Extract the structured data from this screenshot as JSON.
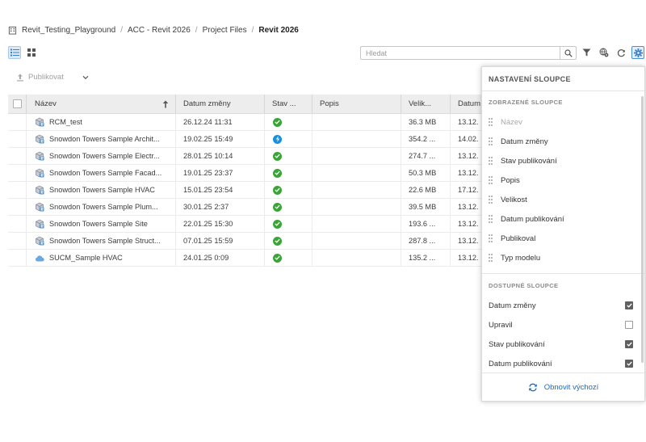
{
  "breadcrumb": {
    "items": [
      "Revit_Testing_Playground",
      "ACC - Revit 2026",
      "Project Files",
      "Revit 2026"
    ],
    "separator": "/"
  },
  "toolbar": {
    "search_placeholder": "Hledat",
    "publish_label": "Publikovat"
  },
  "table": {
    "headers": [
      "Název",
      "Datum změny",
      "Stav ...",
      "Popis",
      "Velik...",
      "Datum"
    ],
    "rows": [
      {
        "name": "RCM_test",
        "date": "26.12.24 11:31",
        "status": "ok",
        "size": "36.3 MB",
        "pub": "13.12.",
        "icon": "revit-model-icon"
      },
      {
        "name": "Snowdon Towers Sample Archit...",
        "date": "19.02.25 15:49",
        "status": "processing",
        "size": "354.2 ...",
        "pub": "14.02.",
        "icon": "revit-model-icon"
      },
      {
        "name": "Snowdon Towers Sample Electr...",
        "date": "28.01.25 10:14",
        "status": "ok",
        "size": "274.7 ...",
        "pub": "13.12.",
        "icon": "revit-model-icon"
      },
      {
        "name": "Snowdon Towers Sample Facad...",
        "date": "19.01.25 23:37",
        "status": "ok",
        "size": "50.3 MB",
        "pub": "13.12.",
        "icon": "revit-model-icon"
      },
      {
        "name": "Snowdon Towers Sample HVAC",
        "date": "15.01.25 23:54",
        "status": "ok",
        "size": "22.6 MB",
        "pub": "17.12.",
        "icon": "revit-model-icon"
      },
      {
        "name": "Snowdon Towers Sample Plum...",
        "date": "30.01.25 2:37",
        "status": "ok",
        "size": "39.5 MB",
        "pub": "13.12.",
        "icon": "revit-model-icon"
      },
      {
        "name": "Snowdon Towers Sample Site",
        "date": "22.01.25 15:30",
        "status": "ok",
        "size": "193.6 ...",
        "pub": "13.12.",
        "icon": "revit-model-icon"
      },
      {
        "name": "Snowdon Towers Sample Struct...",
        "date": "07.01.25 15:59",
        "status": "ok",
        "size": "287.8 ...",
        "pub": "13.12.",
        "icon": "revit-model-icon"
      },
      {
        "name": "SUCM_Sample HVAC",
        "date": "24.01.25 0:09",
        "status": "ok",
        "size": "135.2 ...",
        "pub": "13.12.",
        "icon": "cloud-model-icon"
      }
    ]
  },
  "colors": {
    "status_ok": "#3aa537",
    "status_processing": "#1b8fd8",
    "accent": "#1b6ac0"
  },
  "column_settings": {
    "title": "NASTAVENÍ SLOUPCE",
    "displayed_title": "ZOBRAZENÉ SLOUPCE",
    "displayed": [
      {
        "label": "Název",
        "disabled": true
      },
      {
        "label": "Datum změny",
        "disabled": false
      },
      {
        "label": "Stav publikování",
        "disabled": false
      },
      {
        "label": "Popis",
        "disabled": false
      },
      {
        "label": "Velikost",
        "disabled": false
      },
      {
        "label": "Datum publikování",
        "disabled": false
      },
      {
        "label": "Publikoval",
        "disabled": false
      },
      {
        "label": "Typ modelu",
        "disabled": false
      }
    ],
    "available_title": "DOSTUPNÉ SLOUPCE",
    "available": [
      {
        "label": "Datum změny",
        "checked": true
      },
      {
        "label": "Upravil",
        "checked": false
      },
      {
        "label": "Stav publikování",
        "checked": true
      },
      {
        "label": "Datum publikování",
        "checked": true
      }
    ],
    "reset_label": "Obnovit výchozí"
  }
}
